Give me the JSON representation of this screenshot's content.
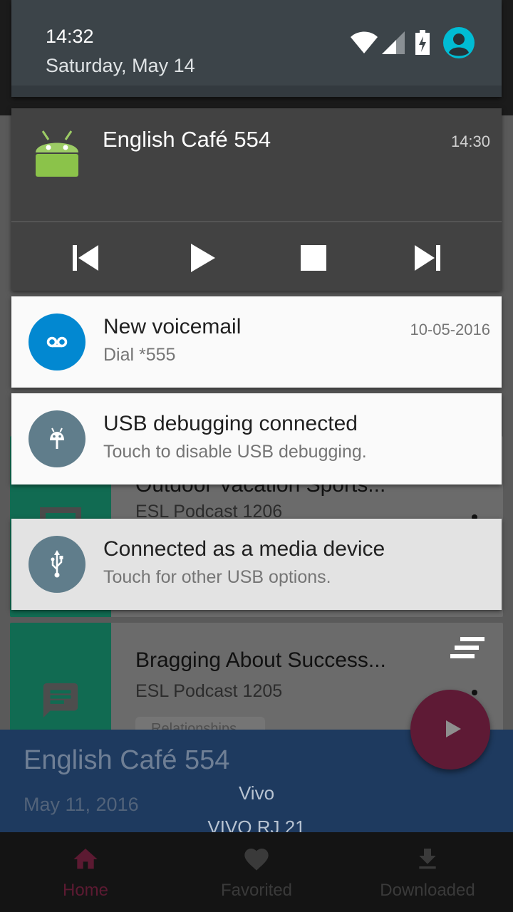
{
  "status_bar": {
    "time": "14:32",
    "date": "Saturday, May 14",
    "icons": [
      "wifi-icon",
      "cell-signal-icon",
      "battery-charging-icon",
      "user-avatar-icon"
    ]
  },
  "notifications": {
    "media": {
      "title": "English Café 554",
      "time": "14:30",
      "app_icon": "android-robot-icon",
      "controls": [
        "skip-previous-icon",
        "play-icon",
        "stop-icon",
        "skip-next-icon"
      ]
    },
    "voicemail": {
      "title": "New voicemail",
      "text": "Dial *555",
      "time": "10-05-2016",
      "icon": "voicemail-icon",
      "color": "#0288d1"
    },
    "usb_debugging": {
      "title": "USB debugging connected",
      "text": "Touch to disable USB debugging.",
      "icon": "android-bug-icon",
      "color": "#607d8b"
    },
    "usb_media": {
      "title": "Connected as a media device",
      "text": "Touch for other USB options.",
      "icon": "usb-icon",
      "color": "#607d8b"
    }
  },
  "background_app": {
    "episodes": [
      {
        "title": "Outdoor Vacation Sports...",
        "podcast": "ESL Podcast 1206"
      },
      {
        "title": "Bragging About Success...",
        "podcast": "ESL Podcast 1205",
        "tag": "Relationships"
      }
    ],
    "now_playing": {
      "title": "English Café 554",
      "date": "May 11, 2016",
      "artist": "Vivo",
      "album": "VIVO RJ 21"
    },
    "bottom_nav": [
      {
        "label": "Home",
        "icon": "home-icon",
        "active": true
      },
      {
        "label": "Favorited",
        "icon": "heart-icon",
        "active": false
      },
      {
        "label": "Downloaded",
        "icon": "download-icon",
        "active": false
      }
    ],
    "colors": {
      "accent": "#c2185b",
      "primary": "#1e3a5f",
      "episode_thumb": "#116b52"
    }
  }
}
